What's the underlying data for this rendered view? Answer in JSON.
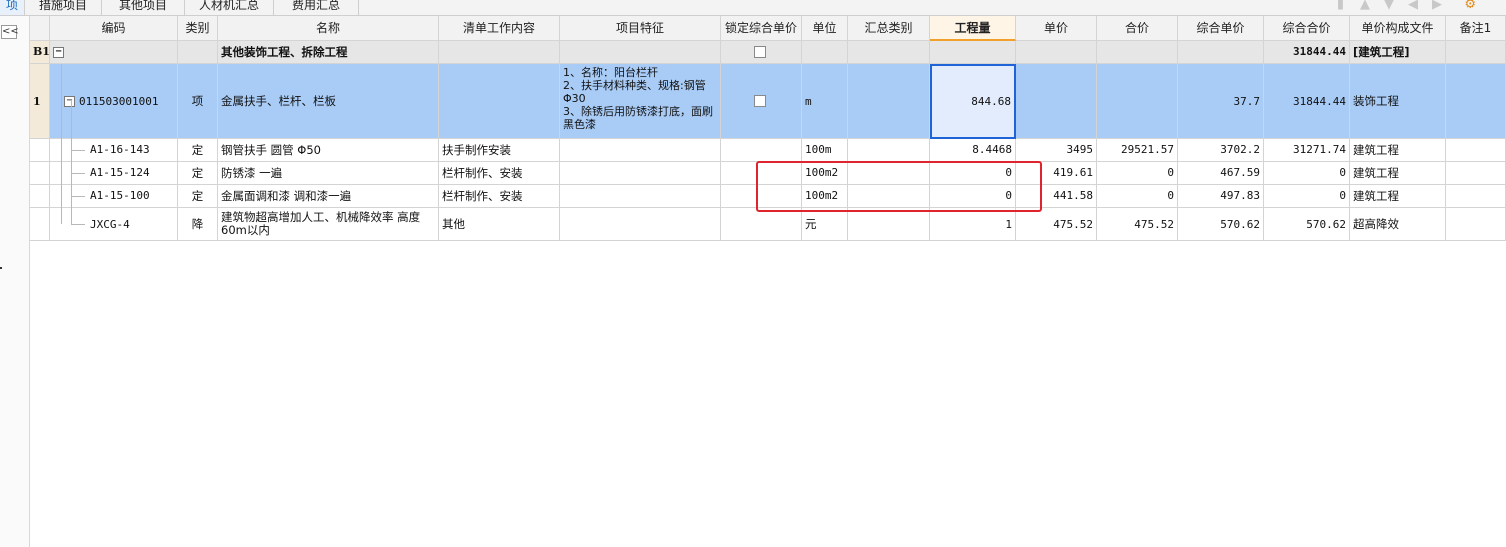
{
  "tabs": [
    "项",
    "措施项目",
    "其他项目",
    "人材机汇总",
    "费用汇总"
  ],
  "columns": [
    "编码",
    "类别",
    "名称",
    "清单工作内容",
    "项目特征",
    "锁定综合单价",
    "单位",
    "汇总类别",
    "工程量",
    "单价",
    "合价",
    "综合单价",
    "综合合价",
    "单价构成文件",
    "备注1"
  ],
  "section": {
    "row_label": "B1",
    "name": "其他装饰工程、拆除工程",
    "total": "31844.44",
    "file": "[建筑工程]"
  },
  "item": {
    "row_label": "1",
    "code": "011503001001",
    "type": "项",
    "name": "金属扶手、栏杆、栏板",
    "feature": "1、名称：阳台栏杆\n2、扶手材料种类、规格:钢管Φ30\n3、除锈后用防锈漆打底，面刷黑色漆",
    "unit": "m",
    "quantity": "844.68",
    "composite_price": "37.7",
    "composite_total": "31844.44",
    "file": "装饰工程"
  },
  "sub_rows": [
    {
      "code": "A1-16-143",
      "type": "定",
      "name": "钢管扶手 圆管 Φ50",
      "work": "扶手制作安装",
      "unit": "100m",
      "quantity": "8.4468",
      "price": "3495",
      "total": "29521.57",
      "composite_price": "3702.2",
      "composite_total": "31271.74",
      "file": "建筑工程"
    },
    {
      "code": "A1-15-124",
      "type": "定",
      "name": "防锈漆 一遍",
      "work": "栏杆制作、安装",
      "unit": "100m2",
      "quantity": "0",
      "price": "419.61",
      "total": "0",
      "composite_price": "467.59",
      "composite_total": "0",
      "file": "建筑工程"
    },
    {
      "code": "A1-15-100",
      "type": "定",
      "name": "金属面调和漆 调和漆一遍",
      "work": "栏杆制作、安装",
      "unit": "100m2",
      "quantity": "0",
      "price": "441.58",
      "total": "0",
      "composite_price": "497.83",
      "composite_total": "0",
      "file": "建筑工程"
    },
    {
      "code": "JXCG-4",
      "type": "降",
      "name": "建筑物超高增加人工、机械降效率 高度60m以内",
      "work": "其他",
      "unit": "元",
      "quantity": "1",
      "price": "475.52",
      "total": "475.52",
      "composite_price": "570.62",
      "composite_total": "570.62",
      "file": "超高降效"
    }
  ],
  "colors": {
    "selected_row": "#a9ccf7",
    "annotation": "#e0242e",
    "highlight_header": "#f1a12b"
  }
}
